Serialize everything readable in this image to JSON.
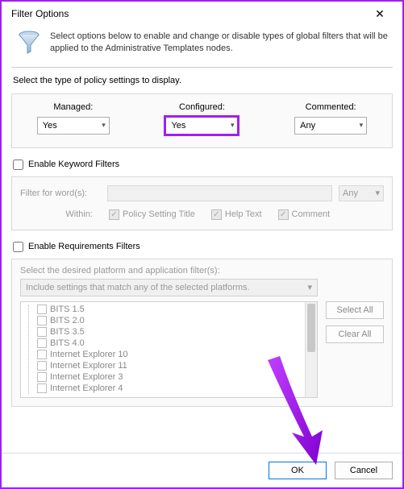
{
  "window": {
    "title": "Filter Options"
  },
  "header": {
    "description": "Select options below to enable and change or disable types of global filters that will be applied to the Administrative Templates nodes."
  },
  "policy": {
    "section_label": "Select the type of policy settings to display.",
    "managed": {
      "label": "Managed:",
      "value": "Yes"
    },
    "configured": {
      "label": "Configured:",
      "value": "Yes"
    },
    "commented": {
      "label": "Commented:",
      "value": "Any"
    }
  },
  "keyword": {
    "enable_label": "Enable Keyword Filters",
    "filter_label": "Filter for word(s):",
    "match_value": "Any",
    "within_label": "Within:",
    "opt_title": "Policy Setting Title",
    "opt_help": "Help Text",
    "opt_comment": "Comment"
  },
  "requirements": {
    "enable_label": "Enable Requirements Filters",
    "desc": "Select the desired platform and application filter(s):",
    "combo_value": "Include settings that match any of the selected platforms.",
    "select_all": "Select All",
    "clear_all": "Clear All",
    "platforms": [
      "BITS 1.5",
      "BITS 2.0",
      "BITS 3.5",
      "BITS 4.0",
      "Internet Explorer 10",
      "Internet Explorer 11",
      "Internet Explorer 3",
      "Internet Explorer 4"
    ]
  },
  "buttons": {
    "ok": "OK",
    "cancel": "Cancel"
  }
}
